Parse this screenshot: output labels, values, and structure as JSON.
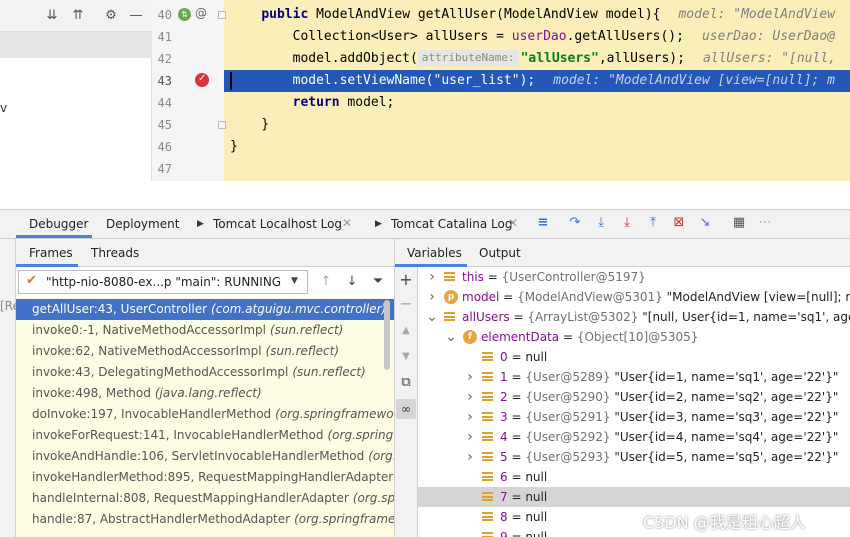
{
  "editor": {
    "lines": [
      {
        "num": "40",
        "parts": [
          {
            "t": "    "
          },
          {
            "t": "public",
            "c": "kw"
          },
          {
            "t": " ModelAndView getAllUser(ModelAndView model){"
          },
          {
            "t": "model: \"ModelAndView",
            "c": "hint"
          }
        ]
      },
      {
        "num": "41",
        "parts": [
          {
            "t": "        Collection<User> allUsers = "
          },
          {
            "t": "userDao",
            "c": "field"
          },
          {
            "t": ".getAllUsers();"
          },
          {
            "t": "userDao: UserDao@",
            "c": "hint"
          }
        ]
      },
      {
        "num": "42",
        "parts": [
          {
            "t": "        model.addObject("
          },
          {
            "t": "attributeName:",
            "c": "phint"
          },
          {
            "t": "\"allUsers\"",
            "c": "str"
          },
          {
            "t": ",allUsers);"
          },
          {
            "t": "allUsers: \"[null,",
            "c": "hint"
          }
        ]
      },
      {
        "num": "43",
        "parts": [
          {
            "t": "        model.setViewName(\"user_list\");"
          },
          {
            "t": "model: \"ModelAndView [view=[null]; m",
            "c": "hintsel"
          }
        ]
      },
      {
        "num": "44",
        "parts": [
          {
            "t": "        "
          },
          {
            "t": "return",
            "c": "kw"
          },
          {
            "t": " model;"
          }
        ]
      },
      {
        "num": "45",
        "parts": [
          {
            "t": "    }"
          }
        ]
      },
      {
        "num": "46",
        "parts": [
          {
            "t": "}"
          }
        ]
      },
      {
        "num": "47",
        "parts": []
      }
    ]
  },
  "left_stub": {
    "fragment_v": "v",
    "fragment_re": "[Re"
  },
  "tabs": {
    "debugger": "Debugger",
    "deployment": "Deployment",
    "tomcat_localhost": "Tomcat Localhost Log",
    "tomcat_catalina": "Tomcat Catalina Log"
  },
  "frames_panel": {
    "tab_frames": "Frames",
    "tab_threads": "Threads",
    "thread_select": "\"http-nio-8080-ex...p \"main\": RUNNING",
    "frames": [
      {
        "method": "getAllUser:43, UserController",
        "pkg": "(com.atguigu.mvc.controller)",
        "selected": true
      },
      {
        "method": "invoke0:-1, NativeMethodAccessorImpl",
        "pkg": "(sun.reflect)"
      },
      {
        "method": "invoke:62, NativeMethodAccessorImpl",
        "pkg": "(sun.reflect)"
      },
      {
        "method": "invoke:43, DelegatingMethodAccessorImpl",
        "pkg": "(sun.reflect)"
      },
      {
        "method": "invoke:498, Method",
        "pkg": "(java.lang.reflect)"
      },
      {
        "method": "doInvoke:197, InvocableHandlerMethod",
        "pkg": "(org.springframewor"
      },
      {
        "method": "invokeForRequest:141, InvocableHandlerMethod",
        "pkg": "(org.springfr"
      },
      {
        "method": "invokeAndHandle:106, ServletInvocableHandlerMethod",
        "pkg": "(org.s"
      },
      {
        "method": "invokeHandlerMethod:895, RequestMappingHandlerAdapter",
        "pkg": "(o"
      },
      {
        "method": "handleInternal:808, RequestMappingHandlerAdapter",
        "pkg": "(org.spr"
      },
      {
        "method": "handle:87, AbstractHandlerMethodAdapter",
        "pkg": "(org.springframew"
      }
    ]
  },
  "variables_panel": {
    "tab_variables": "Variables",
    "tab_output": "Output",
    "rows": [
      {
        "indent": 0,
        "expand": "right",
        "icon": "bars",
        "name": "this",
        "type": "{UserController@5197}",
        "value": ""
      },
      {
        "indent": 0,
        "expand": "right",
        "icon": "p",
        "name": "model",
        "type": "{ModelAndView@5301}",
        "value": "\"ModelAndView [view=[null]; moc"
      },
      {
        "indent": 0,
        "expand": "down",
        "icon": "bars",
        "name": "allUsers",
        "type": "{ArrayList@5302}",
        "value": "\"[null, User{id=1, name='sq1', age='22"
      },
      {
        "indent": 1,
        "expand": "down",
        "icon": "f",
        "name": "elementData",
        "type": "{Object[10]@5305}",
        "value": ""
      },
      {
        "indent": 2,
        "expand": "",
        "icon": "bars",
        "name": "0",
        "type": "",
        "value": "null"
      },
      {
        "indent": 2,
        "expand": "right",
        "icon": "bars",
        "name": "1",
        "type": "{User@5289}",
        "value": "\"User{id=1, name='sq1', age='22'}\""
      },
      {
        "indent": 2,
        "expand": "right",
        "icon": "bars",
        "name": "2",
        "type": "{User@5290}",
        "value": "\"User{id=2, name='sq2', age='22'}\""
      },
      {
        "indent": 2,
        "expand": "right",
        "icon": "bars",
        "name": "3",
        "type": "{User@5291}",
        "value": "\"User{id=3, name='sq3', age='22'}\""
      },
      {
        "indent": 2,
        "expand": "right",
        "icon": "bars",
        "name": "4",
        "type": "{User@5292}",
        "value": "\"User{id=4, name='sq4', age='22'}\""
      },
      {
        "indent": 2,
        "expand": "right",
        "icon": "bars",
        "name": "5",
        "type": "{User@5293}",
        "value": "\"User{id=5, name='sq5', age='22'}\""
      },
      {
        "indent": 2,
        "expand": "",
        "icon": "bars",
        "name": "6",
        "type": "",
        "value": "null"
      },
      {
        "indent": 2,
        "expand": "",
        "icon": "bars",
        "name": "7",
        "type": "",
        "value": "null",
        "selected": true
      },
      {
        "indent": 2,
        "expand": "",
        "icon": "bars",
        "name": "8",
        "type": "",
        "value": "null"
      },
      {
        "indent": 2,
        "expand": "",
        "icon": "bars",
        "name": "9",
        "type": "",
        "value": "null"
      }
    ]
  },
  "watermark": "CSDN @我是粗心超人",
  "colors": {
    "editor_bg": "#fbeeb8",
    "selected_line": "#2357b8",
    "frames_bg": "#fefde3",
    "selected_frame": "#3f72c8",
    "selected_var_row": "#d5d5d5",
    "keyword": "#000080",
    "string": "#067d17"
  }
}
